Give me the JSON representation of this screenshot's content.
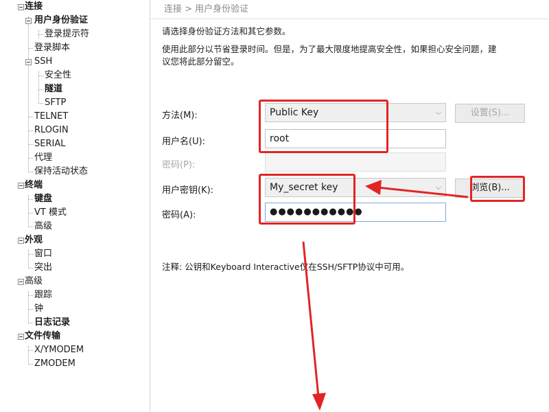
{
  "tree": [
    {
      "label": "连接",
      "bold": true,
      "depth": 0,
      "toggle": true
    },
    {
      "label": "用户身份验证",
      "bold": true,
      "depth": 1,
      "toggle": true
    },
    {
      "label": "登录提示符",
      "bold": false,
      "depth": 2,
      "toggle": false
    },
    {
      "label": "登录脚本",
      "bold": false,
      "depth": 1,
      "toggle": false
    },
    {
      "label": "SSH",
      "bold": false,
      "depth": 1,
      "toggle": true
    },
    {
      "label": "安全性",
      "bold": false,
      "depth": 2,
      "toggle": false
    },
    {
      "label": "隧道",
      "bold": true,
      "depth": 2,
      "toggle": false
    },
    {
      "label": "SFTP",
      "bold": false,
      "depth": 2,
      "toggle": false
    },
    {
      "label": "TELNET",
      "bold": false,
      "depth": 1,
      "toggle": false
    },
    {
      "label": "RLOGIN",
      "bold": false,
      "depth": 1,
      "toggle": false
    },
    {
      "label": "SERIAL",
      "bold": false,
      "depth": 1,
      "toggle": false
    },
    {
      "label": "代理",
      "bold": false,
      "depth": 1,
      "toggle": false
    },
    {
      "label": "保持活动状态",
      "bold": false,
      "depth": 1,
      "toggle": false
    },
    {
      "label": "终端",
      "bold": true,
      "depth": 0,
      "toggle": true
    },
    {
      "label": "键盘",
      "bold": true,
      "depth": 1,
      "toggle": false
    },
    {
      "label": "VT 模式",
      "bold": false,
      "depth": 1,
      "toggle": false
    },
    {
      "label": "高级",
      "bold": false,
      "depth": 1,
      "toggle": false
    },
    {
      "label": "外观",
      "bold": true,
      "depth": 0,
      "toggle": true
    },
    {
      "label": "窗口",
      "bold": false,
      "depth": 1,
      "toggle": false
    },
    {
      "label": "突出",
      "bold": false,
      "depth": 1,
      "toggle": false
    },
    {
      "label": "高级",
      "bold": false,
      "depth": 0,
      "toggle": true
    },
    {
      "label": "跟踪",
      "bold": false,
      "depth": 1,
      "toggle": false
    },
    {
      "label": "钟",
      "bold": false,
      "depth": 1,
      "toggle": false
    },
    {
      "label": "日志记录",
      "bold": true,
      "depth": 1,
      "toggle": false
    },
    {
      "label": "文件传输",
      "bold": true,
      "depth": 0,
      "toggle": true
    },
    {
      "label": "X/YMODEM",
      "bold": false,
      "depth": 1,
      "toggle": false
    },
    {
      "label": "ZMODEM",
      "bold": false,
      "depth": 1,
      "toggle": false
    }
  ],
  "breadcrumb": "连接 > 用户身份验证",
  "description": {
    "line1": "请选择身份验证方法和其它参数。",
    "line2a": "使用此部分以节省登录时间。但是，为了最大限度地提高安全性，如果担心安全问题，建",
    "line2b": "议您将此部分留空。"
  },
  "form": {
    "method_label": "方法(M):",
    "method_value": "Public Key",
    "settings_button": "设置(S)...",
    "username_label": "用户名(U):",
    "username_value": "root",
    "password_disabled_label": "密码(P):",
    "user_key_label": "用户密钥(K):",
    "user_key_value": "My_secret key",
    "browse_button": "浏览(B)...",
    "passphrase_label": "密码(A):",
    "passphrase_value": "●●●●●●●●●●●"
  },
  "note": "注释: 公钥和Keyboard Interactive仅在SSH/SFTP协议中可用。",
  "colors": {
    "annotation": "#e12424",
    "focus_border": "#7fa7d6"
  },
  "icons": {
    "dropdown": "chevron-down-icon",
    "tree_toggle": "minus-box-icon"
  }
}
